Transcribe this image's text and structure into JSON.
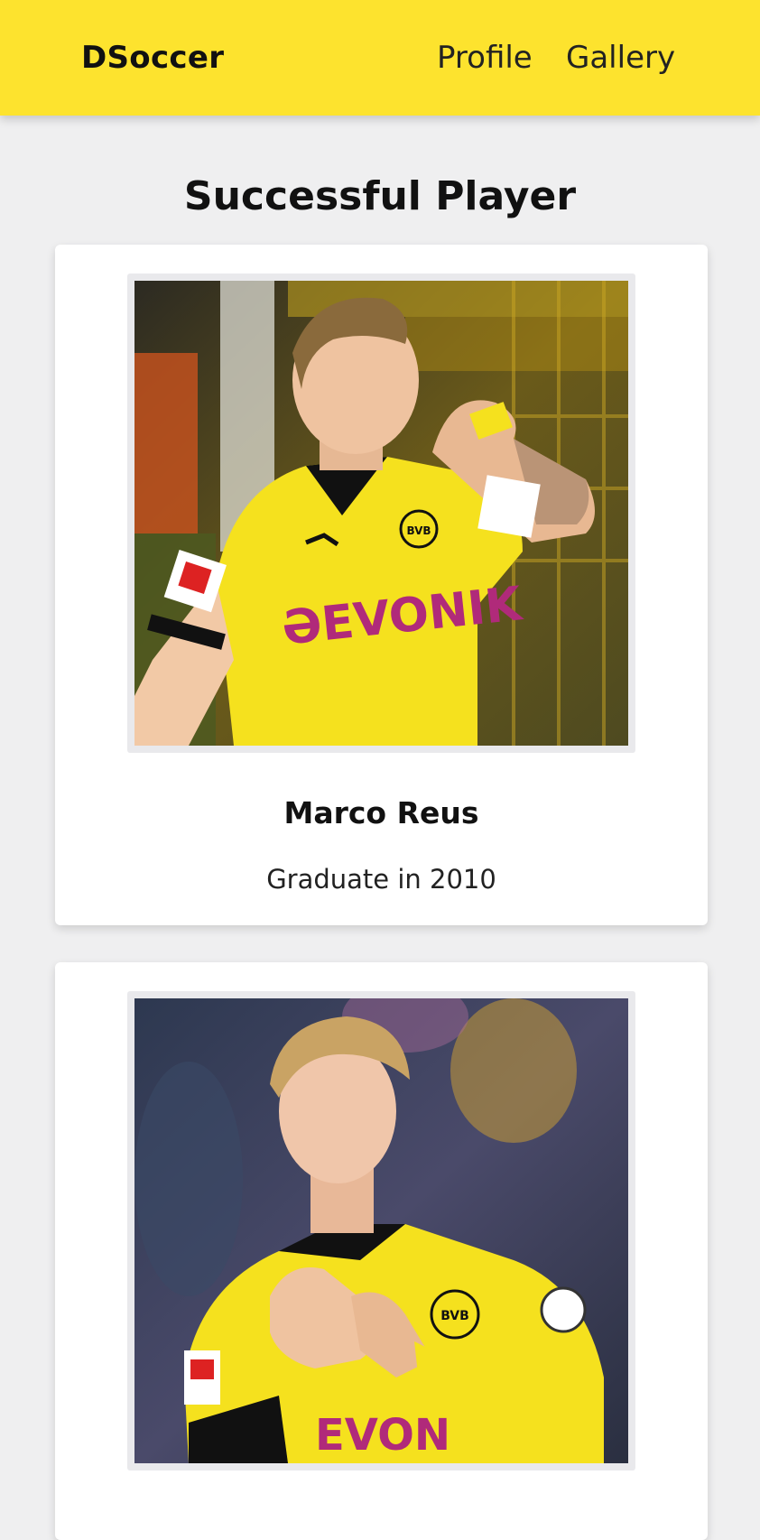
{
  "navbar": {
    "brand": "DSoccer",
    "links": [
      "Profile",
      "Gallery"
    ]
  },
  "section": {
    "title": "Successful Player"
  },
  "players": [
    {
      "name": "Marco Reus",
      "note": "Graduate in 2010",
      "photo_icon": "player-photo",
      "jersey_text": "EVONIK",
      "badge_text": "BVB 09"
    },
    {
      "name": "",
      "note": "",
      "photo_icon": "player-photo",
      "jersey_text": "EVONIK",
      "badge_text": "BVB 09"
    }
  ],
  "colors": {
    "navbar": "#fde32e",
    "page_background": "#efeff0",
    "card": "#ffffff",
    "jersey_yellow": "#f5e11e",
    "sponsor_magenta": "#b02a7a"
  }
}
